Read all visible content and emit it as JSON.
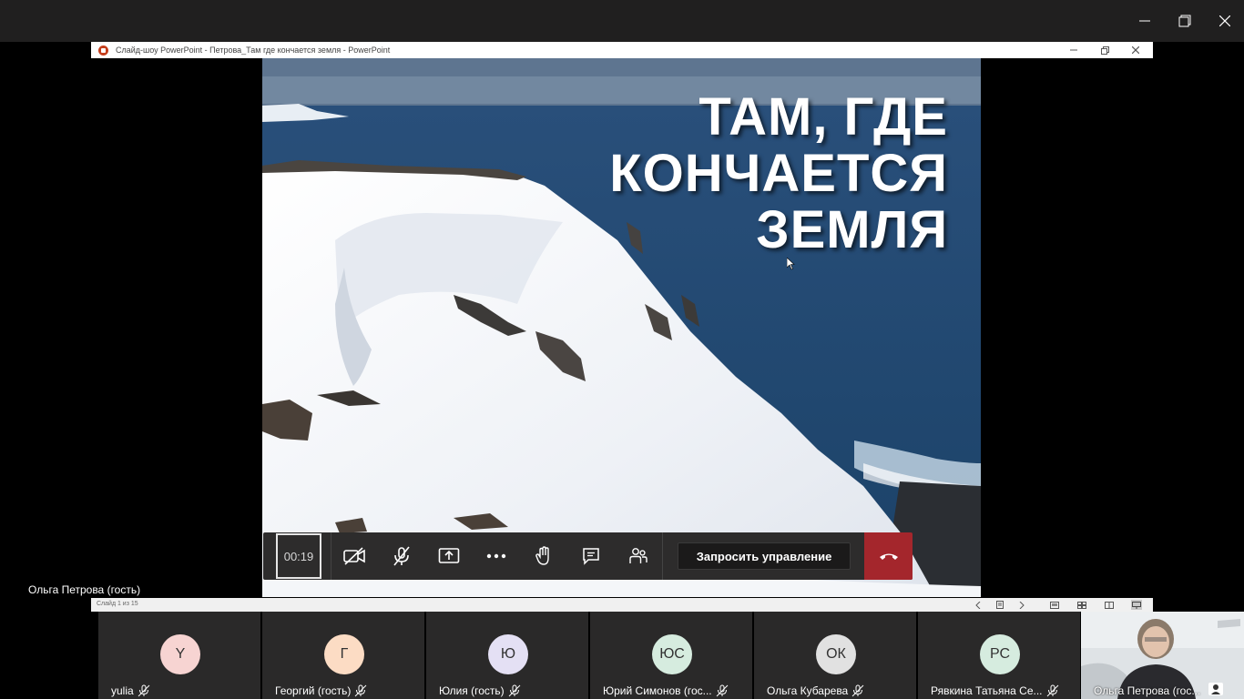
{
  "window": {
    "icons": [
      "minimize-icon",
      "restore-icon",
      "close-icon"
    ]
  },
  "ppt": {
    "title": "Слайд-шоу PowerPoint  -  Петрова_Там где кончается земля - PowerPoint",
    "status_slide": "Слайд 1 из 15"
  },
  "slide": {
    "title": "ТАМ, ГДЕ\nКОНЧАЕТСЯ\nЗЕМЛЯ"
  },
  "toolbar": {
    "timer": "00:19",
    "request_control": "Запросить управление",
    "colors": {
      "hangup": "#a4262c",
      "bar": "#2d2c2c"
    }
  },
  "presenter": {
    "name": "Ольга Петрова (гость)"
  },
  "participants": [
    {
      "initials": "Y",
      "name": "yulia",
      "color": "#f7d4d2"
    },
    {
      "initials": "Г",
      "name": "Георгий (гость)",
      "color": "#fcdcc4"
    },
    {
      "initials": "Ю",
      "name": "Юлия (гость)",
      "color": "#e4e0f4"
    },
    {
      "initials": "ЮС",
      "name": "Юрий Симонов (гос...",
      "color": "#d6ecdf"
    },
    {
      "initials": "ОК",
      "name": "Ольга Кубарева",
      "color": "#e1e1e1"
    },
    {
      "initials": "РС",
      "name": "Рявкина Татьяна Се...",
      "color": "#d6ecdf"
    }
  ],
  "self": {
    "name": "Ольга Петрова (гос..."
  }
}
